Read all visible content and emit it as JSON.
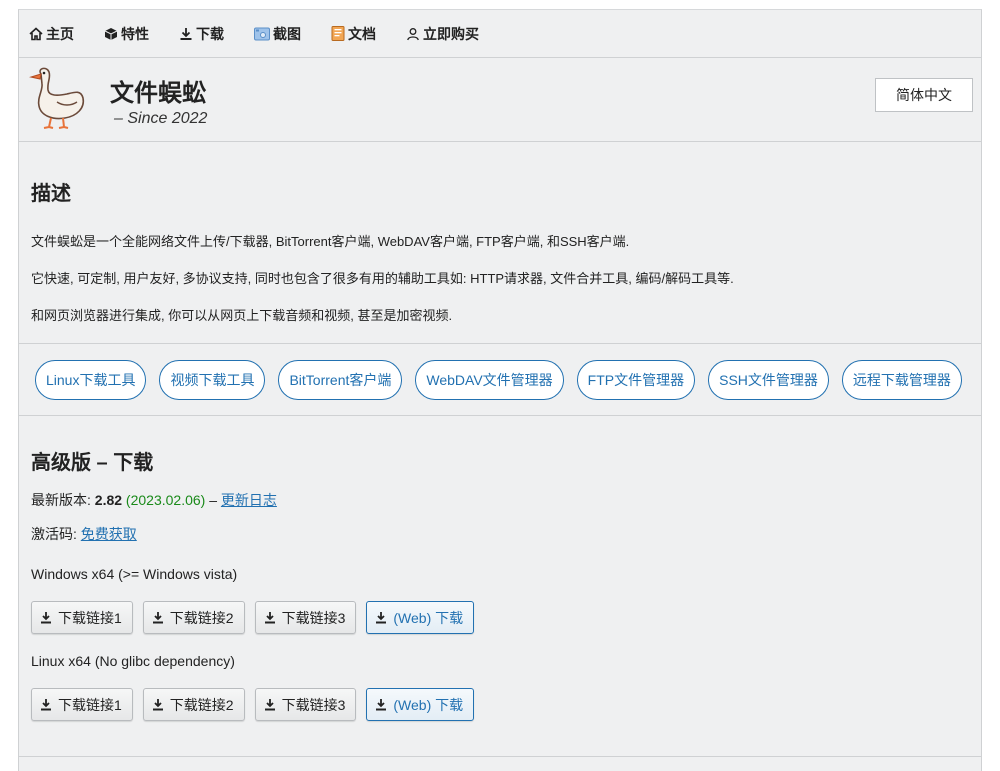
{
  "nav": [
    {
      "label": "主页",
      "icon": "home-icon"
    },
    {
      "label": "特性",
      "icon": "cube-icon"
    },
    {
      "label": "下载",
      "icon": "download-icon"
    },
    {
      "label": "截图",
      "icon": "screenshot-icon"
    },
    {
      "label": "文档",
      "icon": "document-icon"
    },
    {
      "label": "立即购买",
      "icon": "user-icon"
    }
  ],
  "header": {
    "title": "文件蜈蚣",
    "subtitle": "– Since 2022",
    "language_button": "简体中文"
  },
  "description": {
    "heading": "描述",
    "paragraphs": [
      "文件蜈蚣是一个全能网络文件上传/下载器, BitTorrent客户端, WebDAV客户端, FTP客户端, 和SSH客户端.",
      "它快速, 可定制, 用户友好, 多协议支持, 同时也包含了很多有用的辅助工具如: HTTP请求器, 文件合并工具, 编码/解码工具等.",
      "和网页浏览器进行集成, 你可以从网页上下载音频和视频, 甚至是加密视频."
    ]
  },
  "tags": [
    "Linux下载工具",
    "视频下载工具",
    "BitTorrent客户端",
    "WebDAV文件管理器",
    "FTP文件管理器",
    "SSH文件管理器",
    "远程下载管理器"
  ],
  "download": {
    "heading": "高级版 – 下载",
    "version_label": "最新版本:",
    "version": "2.82",
    "date": "(2023.02.06)",
    "separator": "–",
    "changelog_link": "更新日志",
    "activation_label": "激活码:",
    "activation_link": "免费获取",
    "platforms": [
      {
        "name": "Windows x64 (>= Windows vista)",
        "buttons": [
          "下载链接1",
          "下载链接2",
          "下载链接3",
          "(Web) 下载"
        ]
      },
      {
        "name": "Linux x64 (No glibc dependency)",
        "buttons": [
          "下载链接1",
          "下载链接2",
          "下载链接3",
          "(Web) 下载"
        ]
      }
    ]
  },
  "colors": {
    "accent": "#2271b1",
    "date_green": "#1a8a1a",
    "background": "#eff0f1"
  }
}
